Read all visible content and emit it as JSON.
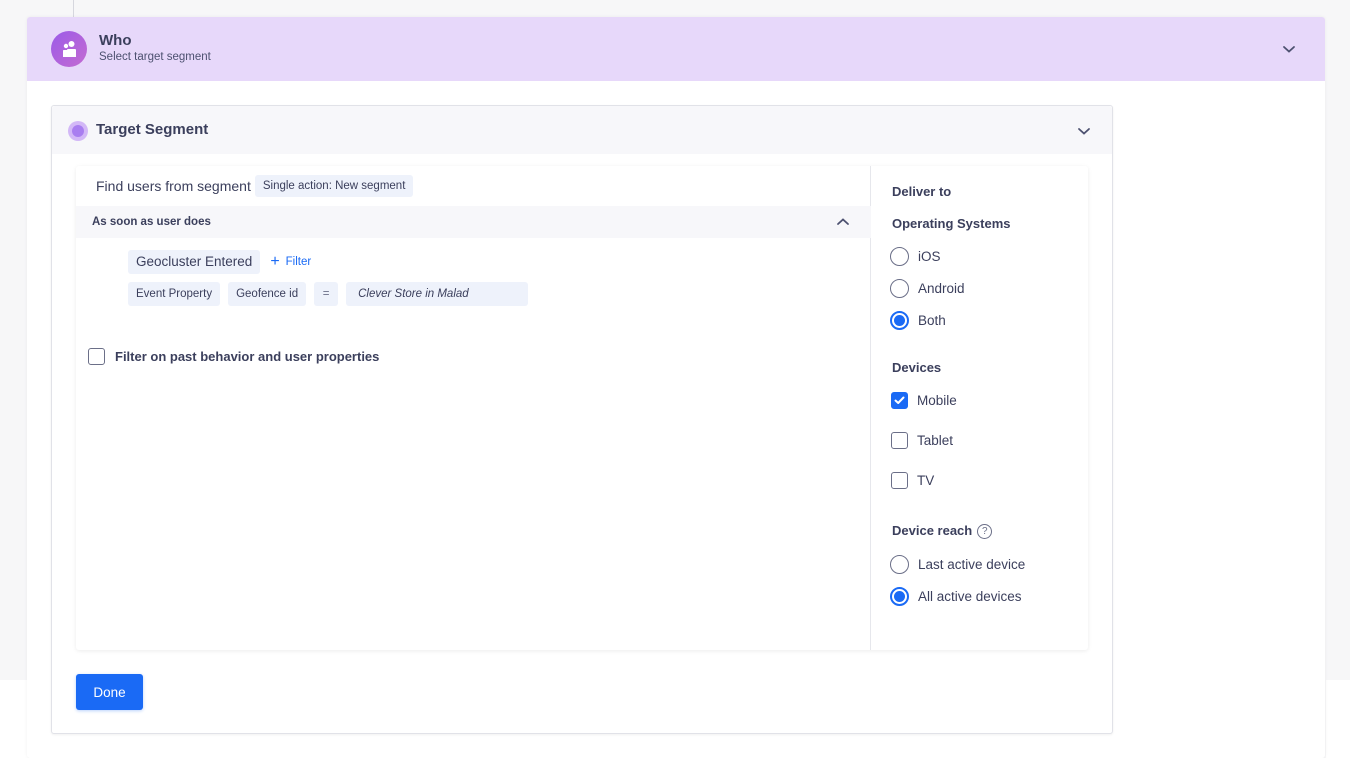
{
  "who": {
    "title": "Who",
    "subtitle": "Select target segment",
    "icon": "users-icon",
    "header_color": "#e7d8fa"
  },
  "target_segment": {
    "title": "Target Segment",
    "find_label": "Find users from segment",
    "segment_tag": "Single action: New segment",
    "trigger_label": "As soon as user does",
    "event": "Geocluster Entered",
    "add_filter_label": "Filter",
    "property": {
      "type": "Event Property",
      "name": "Geofence id",
      "operator": "=",
      "value": "Clever Store in Malad"
    },
    "past_behavior": {
      "label": "Filter on past behavior and user properties",
      "checked": false
    }
  },
  "deliver_to": {
    "heading": "Deliver to",
    "os_heading": "Operating Systems",
    "os_options": [
      {
        "label": "iOS",
        "selected": false
      },
      {
        "label": "Android",
        "selected": false
      },
      {
        "label": "Both",
        "selected": true
      }
    ],
    "devices_heading": "Devices",
    "devices": [
      {
        "label": "Mobile",
        "checked": true
      },
      {
        "label": "Tablet",
        "checked": false
      },
      {
        "label": "TV",
        "checked": false
      }
    ],
    "reach_heading": "Device reach",
    "reach_options": [
      {
        "label": "Last active device",
        "selected": false
      },
      {
        "label": "All active devices",
        "selected": true
      }
    ]
  },
  "actions": {
    "done_label": "Done"
  },
  "colors": {
    "accent": "#1a6af5",
    "who_avatar": "#9b5be8",
    "segment_dot": "#a97ef0"
  }
}
